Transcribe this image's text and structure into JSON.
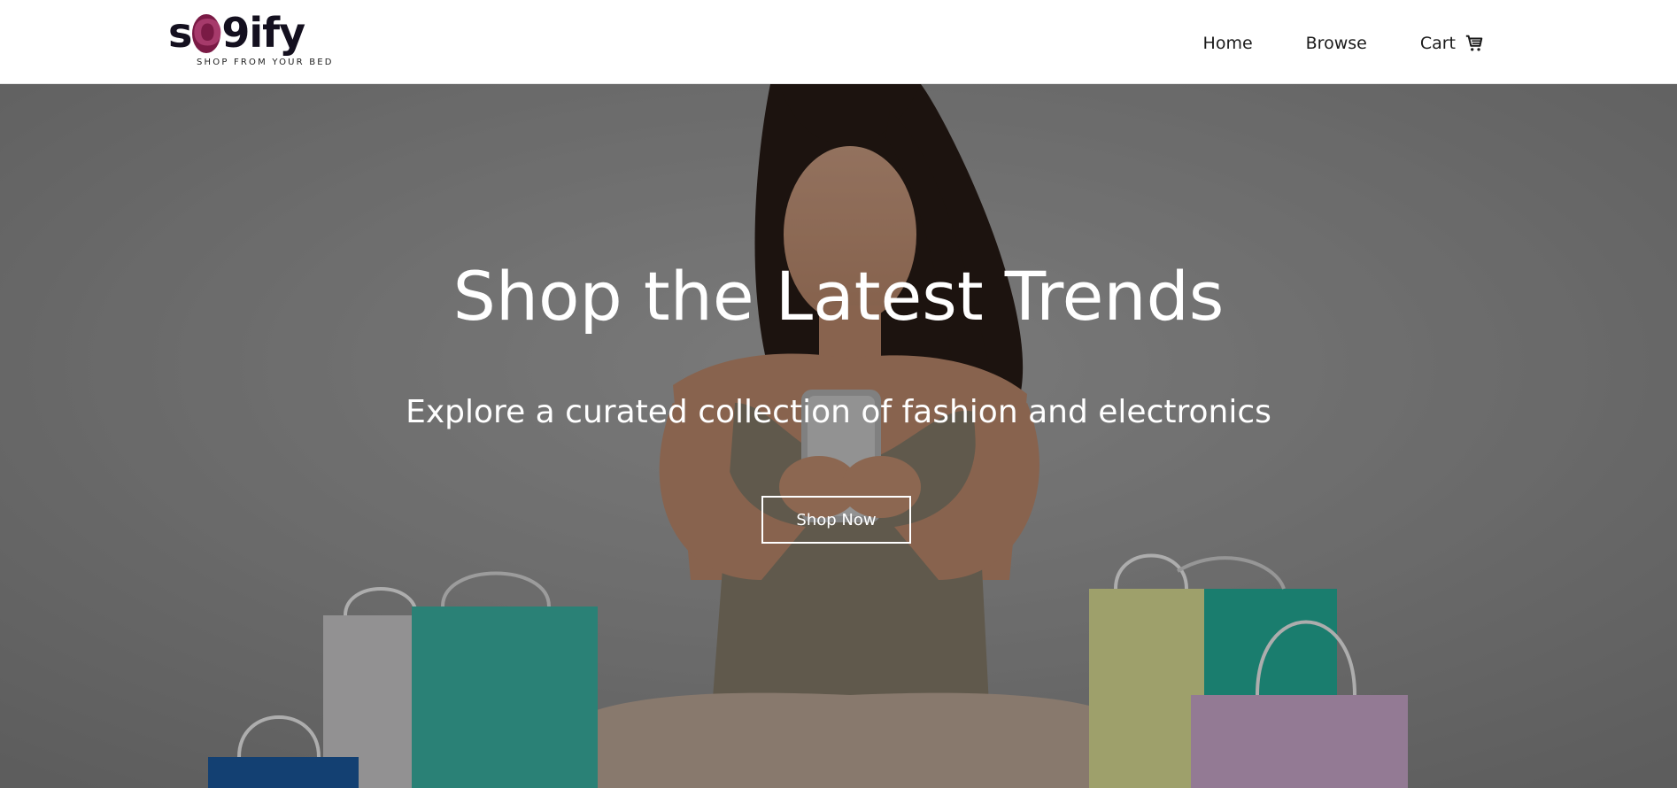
{
  "header": {
    "logo": {
      "word_prefix": "s",
      "word_accent": "O",
      "word_suffix": "9ify",
      "tagline": "SHOP FROM YOUR BED"
    },
    "nav": {
      "home": "Home",
      "browse": "Browse",
      "cart": "Cart",
      "cart_icon": "shopping-cart-icon"
    }
  },
  "hero": {
    "title": "Shop the Latest Trends",
    "subtitle": "Explore a curated collection of fashion and electronics",
    "button_label": "Shop Now",
    "image_subject": "hero-photo"
  },
  "colors": {
    "logo_dark": "#14101f",
    "logo_accent": "#7a1a45",
    "hero_text": "#ffffff",
    "nav_text": "#1a1a1a"
  }
}
